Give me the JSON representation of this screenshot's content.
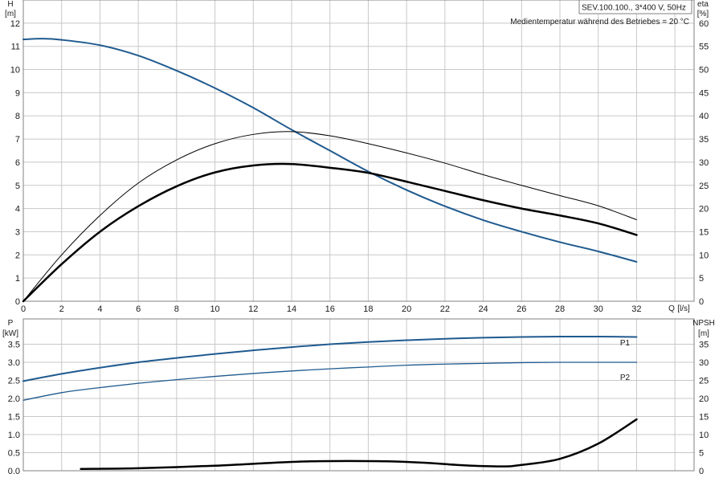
{
  "header": {
    "model": "SEV.100.100., 3*400 V, 50Hz",
    "note": "Medientemperatur während des Betriebes = 20 °C"
  },
  "colors": {
    "grid": "#c8c8c8",
    "frame": "#808080",
    "blue": "#1f5a8f",
    "black": "#000000",
    "text": "#1a1a1a"
  },
  "chart_data": [
    {
      "type": "line",
      "panel": "top",
      "xlabel": "Q",
      "xunit": "[l/s]",
      "ylabel": "H",
      "yunit": "[m]",
      "y2label": "eta",
      "y2unit": "[%]",
      "xlim": [
        0,
        35
      ],
      "ylim": [
        0,
        13
      ],
      "y2lim": [
        0,
        65
      ],
      "grid": true,
      "x_ticks": [
        "0",
        "2",
        "4",
        "6",
        "8",
        "10",
        "12",
        "14",
        "16",
        "18",
        "20",
        "22",
        "24",
        "26",
        "28",
        "30",
        "32"
      ],
      "y_ticks": [
        "0",
        "1",
        "2",
        "3",
        "4",
        "5",
        "6",
        "7",
        "8",
        "9",
        "10",
        "11",
        "12"
      ],
      "y2_ticks": [
        "0",
        "5",
        "10",
        "15",
        "20",
        "25",
        "30",
        "35",
        "40",
        "45",
        "50",
        "55",
        "60"
      ],
      "series": [
        {
          "key": "H",
          "axis": "left",
          "color": "#1f5a8f",
          "width": 2,
          "x": [
            0,
            1,
            2,
            4,
            6,
            8,
            10,
            12,
            14,
            16,
            18,
            20,
            22,
            24,
            26,
            28,
            30,
            32
          ],
          "y": [
            11.3,
            11.33,
            11.28,
            11.05,
            10.6,
            9.95,
            9.2,
            8.35,
            7.4,
            6.5,
            5.6,
            4.8,
            4.1,
            3.5,
            3.0,
            2.55,
            2.15,
            1.7
          ]
        },
        {
          "key": "eta_thin",
          "axis": "right",
          "color": "#000000",
          "width": 1,
          "x": [
            0,
            2,
            4,
            6,
            8,
            10,
            12,
            14,
            16,
            18,
            20,
            22,
            24,
            26,
            28,
            30,
            32
          ],
          "y": [
            0,
            10,
            18.5,
            25.5,
            30.5,
            34,
            36,
            36.6,
            35.7,
            34,
            32,
            29.8,
            27.3,
            25,
            22.8,
            20.6,
            17.6
          ]
        },
        {
          "key": "eta_thick",
          "axis": "right",
          "color": "#000000",
          "width": 2.5,
          "x": [
            0,
            2,
            4,
            6,
            8,
            10,
            12,
            14,
            16,
            18,
            20,
            22,
            24,
            26,
            28,
            30,
            32
          ],
          "y": [
            0,
            8,
            15,
            20.5,
            24.8,
            27.8,
            29.3,
            29.6,
            28.8,
            27.7,
            25.8,
            23.8,
            21.8,
            20,
            18.5,
            16.8,
            14.3
          ]
        }
      ]
    },
    {
      "type": "line",
      "panel": "bottom",
      "ylabel": "P",
      "yunit": "[kW]",
      "y2label": "NPSH",
      "y2unit": "[m]",
      "xlim": [
        0,
        35
      ],
      "ylim": [
        0,
        4.2
      ],
      "y2lim": [
        0,
        42
      ],
      "grid": true,
      "y_ticks": [
        "0.0",
        "0.5",
        "1.0",
        "1.5",
        "2.0",
        "2.5",
        "3.0",
        "3.5"
      ],
      "y2_ticks": [
        "0",
        "5",
        "10",
        "15",
        "20",
        "25",
        "30",
        "35"
      ],
      "series": [
        {
          "key": "P1",
          "name": "P1",
          "axis": "left",
          "color": "#1f5a8f",
          "width": 2,
          "x": [
            0,
            2,
            4,
            6,
            8,
            10,
            12,
            14,
            16,
            18,
            20,
            22,
            24,
            26,
            28,
            30,
            32
          ],
          "y": [
            2.48,
            2.68,
            2.85,
            3.0,
            3.12,
            3.23,
            3.33,
            3.42,
            3.5,
            3.56,
            3.61,
            3.65,
            3.68,
            3.7,
            3.71,
            3.71,
            3.7
          ]
        },
        {
          "key": "P2",
          "name": "P2",
          "axis": "left",
          "color": "#1f5a8f",
          "width": 1.3,
          "x": [
            0,
            2,
            4,
            6,
            8,
            10,
            12,
            14,
            16,
            18,
            20,
            22,
            24,
            26,
            28,
            30,
            32
          ],
          "y": [
            1.95,
            2.16,
            2.3,
            2.42,
            2.52,
            2.61,
            2.69,
            2.76,
            2.82,
            2.87,
            2.92,
            2.95,
            2.97,
            2.99,
            3.0,
            3.0,
            3.0
          ]
        },
        {
          "key": "NPSH",
          "axis": "right",
          "color": "#000000",
          "width": 2.5,
          "x": [
            3,
            6,
            10,
            13,
            15,
            17,
            19,
            21,
            23,
            25,
            26,
            28,
            30,
            32
          ],
          "y": [
            0.5,
            0.7,
            1.4,
            2.2,
            2.6,
            2.7,
            2.6,
            2.2,
            1.5,
            1.2,
            1.6,
            3.3,
            7.5,
            14.2
          ]
        }
      ]
    }
  ]
}
